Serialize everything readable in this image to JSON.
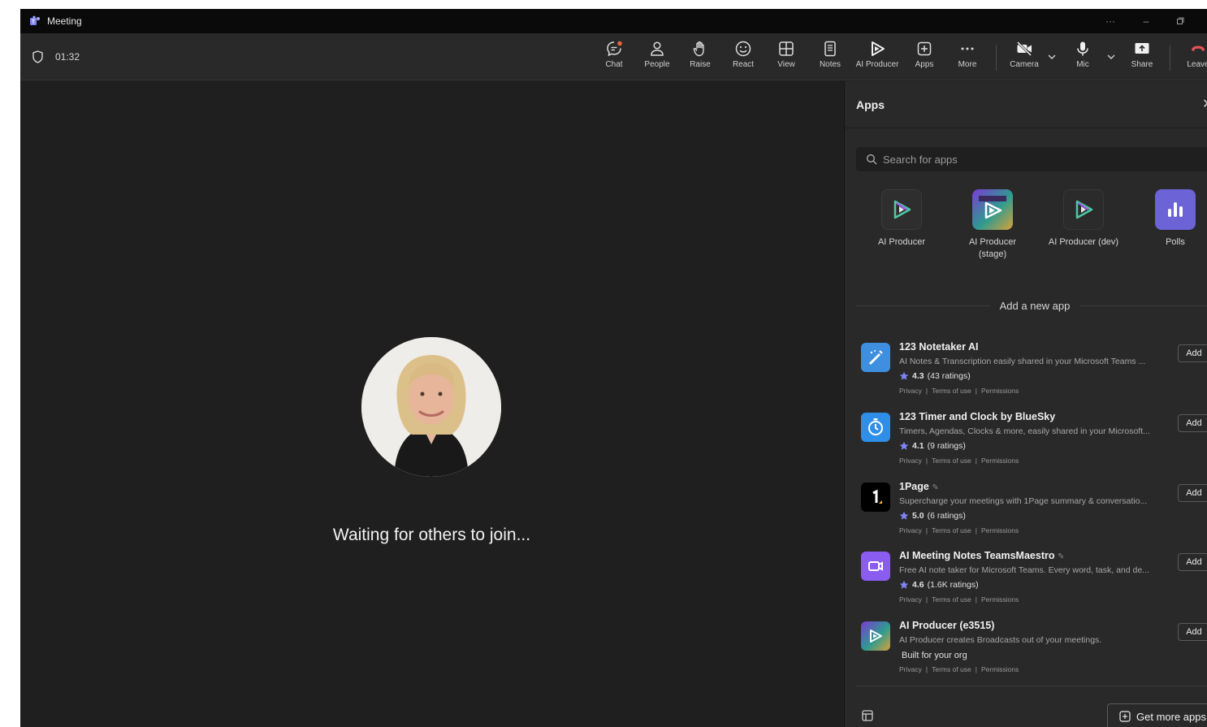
{
  "window": {
    "title": "Meeting",
    "title_bar_buttons": [
      "more-icon",
      "minimize-icon",
      "restore-icon"
    ]
  },
  "toolbar": {
    "timer": "01:32",
    "buttons": [
      {
        "label": "Chat",
        "icon": "chat-icon"
      },
      {
        "label": "People",
        "icon": "people-icon"
      },
      {
        "label": "Raise",
        "icon": "raise-hand-icon"
      },
      {
        "label": "React",
        "icon": "react-icon"
      },
      {
        "label": "View",
        "icon": "view-icon"
      },
      {
        "label": "Notes",
        "icon": "notes-icon"
      },
      {
        "label": "AI Producer",
        "icon": "ai-producer-icon"
      },
      {
        "label": "Apps",
        "icon": "apps-icon"
      },
      {
        "label": "More",
        "icon": "more-icon"
      },
      {
        "label": "Camera",
        "icon": "camera-off-icon"
      },
      {
        "label": "Mic",
        "icon": "mic-icon"
      },
      {
        "label": "Share",
        "icon": "share-icon"
      },
      {
        "label": "Leave",
        "icon": "leave-icon"
      }
    ]
  },
  "stage": {
    "status": "Waiting for others to join..."
  },
  "apps_panel": {
    "title": "Apps",
    "search_placeholder": "Search for apps",
    "pinned": [
      {
        "name": "AI Producer"
      },
      {
        "name": "AI Producer (stage)"
      },
      {
        "name": "AI Producer (dev)"
      },
      {
        "name": "Polls"
      }
    ],
    "add_new_label": "Add a new app",
    "apps": [
      {
        "name": "123 Notetaker AI",
        "description": "AI Notes & Transcription easily shared in your Microsoft Teams ...",
        "rating": "4.3",
        "rating_count": "(43 ratings)",
        "action": "Add"
      },
      {
        "name": "123 Timer and Clock by BlueSky",
        "description": "Timers, Agendas, Clocks & more, easily shared in your Microsoft...",
        "rating": "4.1",
        "rating_count": "(9 ratings)",
        "action": "Add"
      },
      {
        "name": "1Page",
        "description": "Supercharge your meetings with 1Page summary & conversatio...",
        "rating": "5.0",
        "rating_count": "(6 ratings)",
        "action": "Add"
      },
      {
        "name": "AI Meeting Notes TeamsMaestro",
        "description": "Free AI note taker for Microsoft Teams. Every word, task, and de...",
        "rating": "4.6",
        "rating_count": "(1.6K ratings)",
        "action": "Add"
      },
      {
        "name": "AI Producer (e3515)",
        "description": "AI Producer creates Broadcasts out of your meetings.",
        "built": "Built for your org",
        "action": "Add"
      }
    ],
    "links": {
      "privacy": "Privacy",
      "terms": "Terms of use",
      "permissions": "Permissions",
      "separator": "|"
    },
    "get_more": "Get more apps"
  },
  "colors": {
    "accent": "#7f85f5",
    "leave": "#e05454",
    "notify": "#e8643c",
    "star": "#7f85f5"
  }
}
